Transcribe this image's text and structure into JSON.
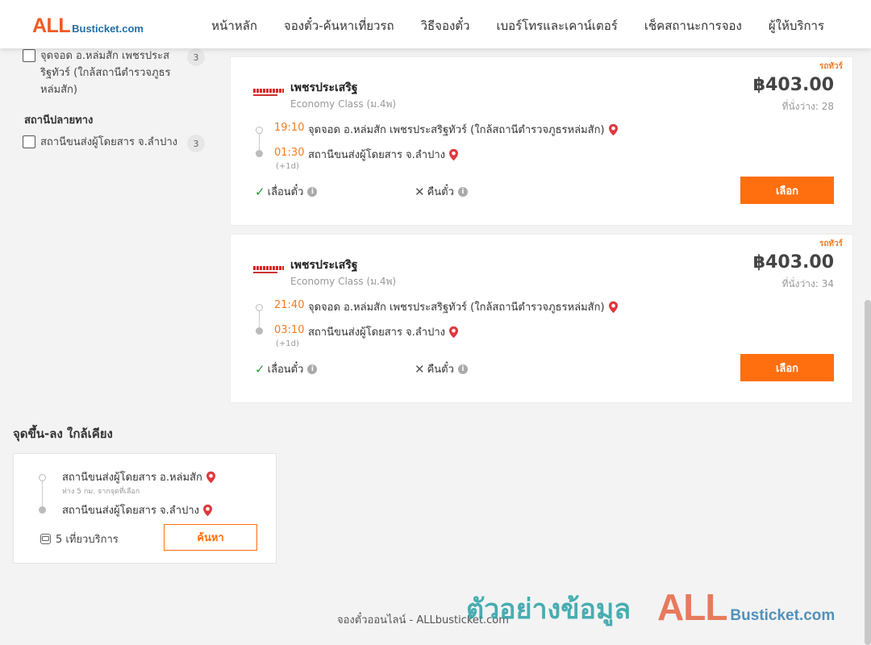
{
  "header": {
    "logo_all": "ALL",
    "logo_rest": "Busticket.com",
    "nav": [
      "หน้าหลัก",
      "จองตั๋ว-ค้นหาเที่ยวรถ",
      "วิธีจองตั๋ว",
      "เบอร์โทรและเคาน์เตอร์",
      "เช็คสถานะการจอง",
      "ผู้ให้บริการ"
    ]
  },
  "filters": {
    "origin_item": {
      "label": "จุดจอด อ.หล่มสัก เพชรประสริฐทัวร์ (ใกล้สถานีตำรวจภูธรหล่มสัก)",
      "count": "3"
    },
    "destination_heading": "สถานีปลายทาง",
    "destination_item": {
      "label": "สถานีขนส่งผู้โดยสาร จ.ลำปาง",
      "count": "3"
    }
  },
  "trips": [
    {
      "tag": "รถทัวร์",
      "operator": "เพชรประเสริฐ",
      "class": "Economy Class (ม.4พ)",
      "price": "฿403.00",
      "seats": "ที่นั่งว่าง: 28",
      "depart_time": "19:10",
      "depart_place": "จุดจอด อ.หล่มสัก เพชรประสริฐทัวร์ (ใกล้สถานีตำรวจภูธรหล่มสัก)",
      "arrive_time": "01:30",
      "arrive_place": "สถานีขนส่งผู้โดยสาร จ.ลำปาง",
      "next_day": "(+1d)",
      "postpone": "เลื่อนตั๋ว",
      "refund": "คืนตั๋ว",
      "select": "เลือก"
    },
    {
      "tag": "รถทัวร์",
      "operator": "เพชรประเสริฐ",
      "class": "Economy Class (ม.4พ)",
      "price": "฿403.00",
      "seats": "ที่นั่งว่าง: 34",
      "depart_time": "21:40",
      "depart_place": "จุดจอด อ.หล่มสัก เพชรประสริฐทัวร์ (ใกล้สถานีตำรวจภูธรหล่มสัก)",
      "arrive_time": "03:10",
      "arrive_place": "สถานีขนส่งผู้โดยสาร จ.ลำปาง",
      "next_day": "(+1d)",
      "postpone": "เลื่อนตั๋ว",
      "refund": "คืนตั๋ว",
      "select": "เลือก"
    }
  ],
  "nearby": {
    "title": "จุดขึ้น-ลง ใกล้เคียง",
    "from": "สถานีขนส่งผู้โดยสาร อ.หล่มสัก",
    "from_sub": "ห่าง 5 กม. จากจุดที่เลือก",
    "to": "สถานีขนส่งผู้โดยสาร จ.ลำปาง",
    "trips": "5 เที่ยวบริการ",
    "search": "ค้นหา"
  },
  "footer": {
    "text": "จองตั๋วออนไลน์ - ALLbusticket.com",
    "watermark": "ตัวอย่างข้อมูล",
    "wm_all": "ALL",
    "wm_rest": "Busticket.com"
  },
  "colors": {
    "accent": "#ff6f0f",
    "time": "#f47b20",
    "pin": "#e0383e",
    "check": "#2a9d3c"
  }
}
